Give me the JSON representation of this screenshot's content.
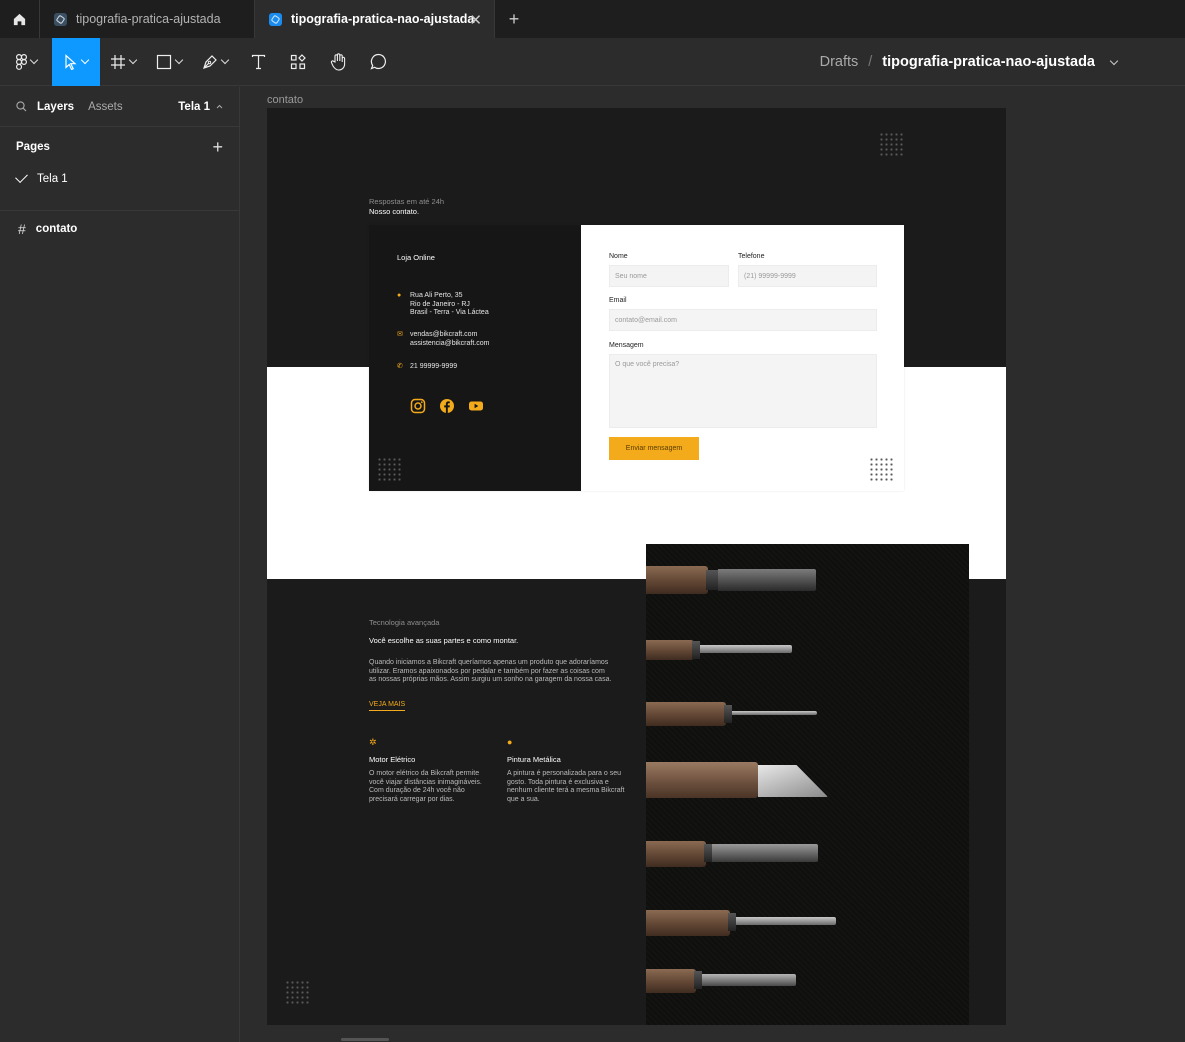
{
  "tabs": [
    {
      "label": "tipografia-pratica-ajustada",
      "active": false
    },
    {
      "label": "tipografia-pratica-nao-ajustada",
      "active": true
    }
  ],
  "toolbar": {
    "tools": [
      "main-menu",
      "move",
      "frame",
      "shape",
      "pen",
      "text",
      "resources",
      "hand",
      "comment"
    ],
    "breadcrumb": {
      "root": "Drafts",
      "sep": "/",
      "file": "tipografia-pratica-nao-ajustada"
    }
  },
  "leftpanel": {
    "layers_tab": "Layers",
    "assets_tab": "Assets",
    "current_page": "Tela 1",
    "pages_title": "Pages",
    "pages": [
      "Tela 1"
    ],
    "layers": [
      "contato"
    ]
  },
  "canvas": {
    "frame_label": "contato",
    "design": {
      "kicker": "Respostas em até 24h",
      "heading": "Nosso contato.",
      "store_title": "Loja Online",
      "address": [
        "Rua Ali Perto, 35",
        "Rio de Janeiro - RJ",
        "Brasil - Terra - Via Láctea"
      ],
      "emails": [
        "vendas@bikcraft.com",
        "assistencia@bikcraft.com"
      ],
      "phone": "21 99999-9999",
      "form": {
        "name_label": "Nome",
        "name_placeholder": "Seu nome",
        "phone_label": "Telefone",
        "phone_placeholder": "(21) 99999-9999",
        "email_label": "Email",
        "email_placeholder": "contato@email.com",
        "message_label": "Mensagem",
        "message_placeholder": "O que você precisa?",
        "submit": "Enviar mensagem"
      },
      "tech_kicker": "Tecnologia avançada",
      "tech_title": "Você escolhe as suas partes e como montar.",
      "tech_body": "Quando iniciamos a Bikcraft queríamos apenas um produto que adoraríamos utilizar. Eramos apaixonados por pedalar e também por fazer as coisas com as nossas próprias mãos. Assim surgiu um sonho na garagem da nossa casa.",
      "veja_mais": "VEJA MAIS",
      "features": [
        {
          "title": "Motor Elétrico",
          "desc": "O motor elétrico da Bikcraft permite você viajar distâncias inimagináveis. Com duração de 24h você não precisará carregar por dias."
        },
        {
          "title": "Pintura Metálica",
          "desc": "A pintura é personalizada para o seu gosto. Toda pintura é exclusiva e nenhum cliente terá a mesma Bikcraft que a sua."
        }
      ]
    }
  },
  "colors": {
    "accent": "#f3aa1b",
    "figma_blue": "#0d99ff",
    "dark": "#1b1b1b"
  }
}
